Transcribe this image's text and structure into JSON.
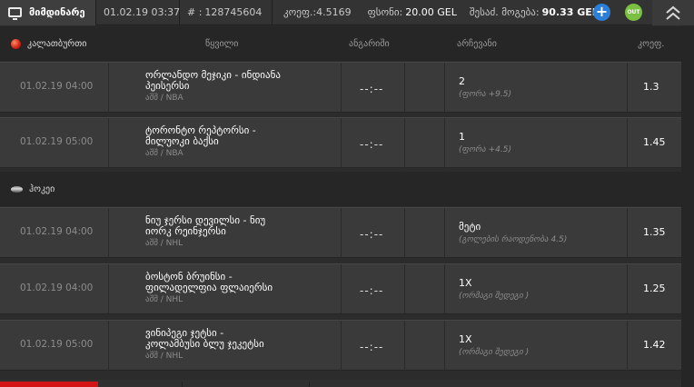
{
  "topbar": {
    "current_label": "მიმდინარე",
    "datetime": "01.02.19 03:37",
    "ticket_label": "# :",
    "ticket_number": "128745604",
    "coef_label": "კოეფ.:",
    "coef_value": "4.5169",
    "stake_label": "ფსონი:",
    "stake_value": "20.00 GEL",
    "payout_label": "შესაძ. მოგება:",
    "payout_value": "90.33 GEL",
    "add_icon": "plus-circle-icon",
    "cashout_label": "OUT",
    "collapse_icon": "double-chevron-up-icon"
  },
  "columns": {
    "event": "წყვილი",
    "result": "ანგარიში",
    "choice": "არჩევანი",
    "odds": "კოეფ."
  },
  "sports": [
    {
      "name": "კალათბურთი",
      "icon": "basketball-icon"
    },
    {
      "name": "ჰოკეი",
      "icon": "hockey-puck-icon"
    }
  ],
  "bets": [
    {
      "date": "01.02.19 04:00",
      "event_line1": "ორლანდო მეჯიკი - ინდიანა",
      "event_line2": "პეისერსი",
      "league": "აშშ / NBA",
      "result": "--:--",
      "choice": "2",
      "choice_sub": "(ფორა +9.5)",
      "odds": "1.3"
    },
    {
      "date": "01.02.19 05:00",
      "event_line1": "ტორონტო რეპტორსი -",
      "event_line2": "მილუოკი ბაქსი",
      "league": "აშშ / NBA",
      "result": "--:--",
      "choice": "1",
      "choice_sub": "(ფორა +4.5)",
      "odds": "1.45"
    },
    {
      "date": "01.02.19 04:00",
      "event_line1": "ნიუ ჯერსი დევილსი - ნიუ",
      "event_line2": "იორკ რეინჯერსი",
      "league": "აშშ / NHL",
      "result": "--:--",
      "choice": "მეტი",
      "choice_sub": "(გოლების რაოდენობა 4.5)",
      "odds": "1.35"
    },
    {
      "date": "01.02.19 04:00",
      "event_line1": "ბოსტონ ბრუინსი -",
      "event_line2": "ფილადელფია ფლაიერსი",
      "league": "აშშ / NHL",
      "result": "--:--",
      "choice": "1X",
      "choice_sub": "(ორმაგი შედეგი )",
      "odds": "1.25"
    },
    {
      "date": "01.02.19 05:00",
      "event_line1": "ვინიპეგი ჯეტსი -",
      "event_line2": "კოლამბუსი ბლუ ჯეკეტსი",
      "league": "აშშ / NHL",
      "result": "--:--",
      "choice": "1X",
      "choice_sub": "(ორმაგი შედეგი )",
      "odds": "1.42"
    }
  ]
}
